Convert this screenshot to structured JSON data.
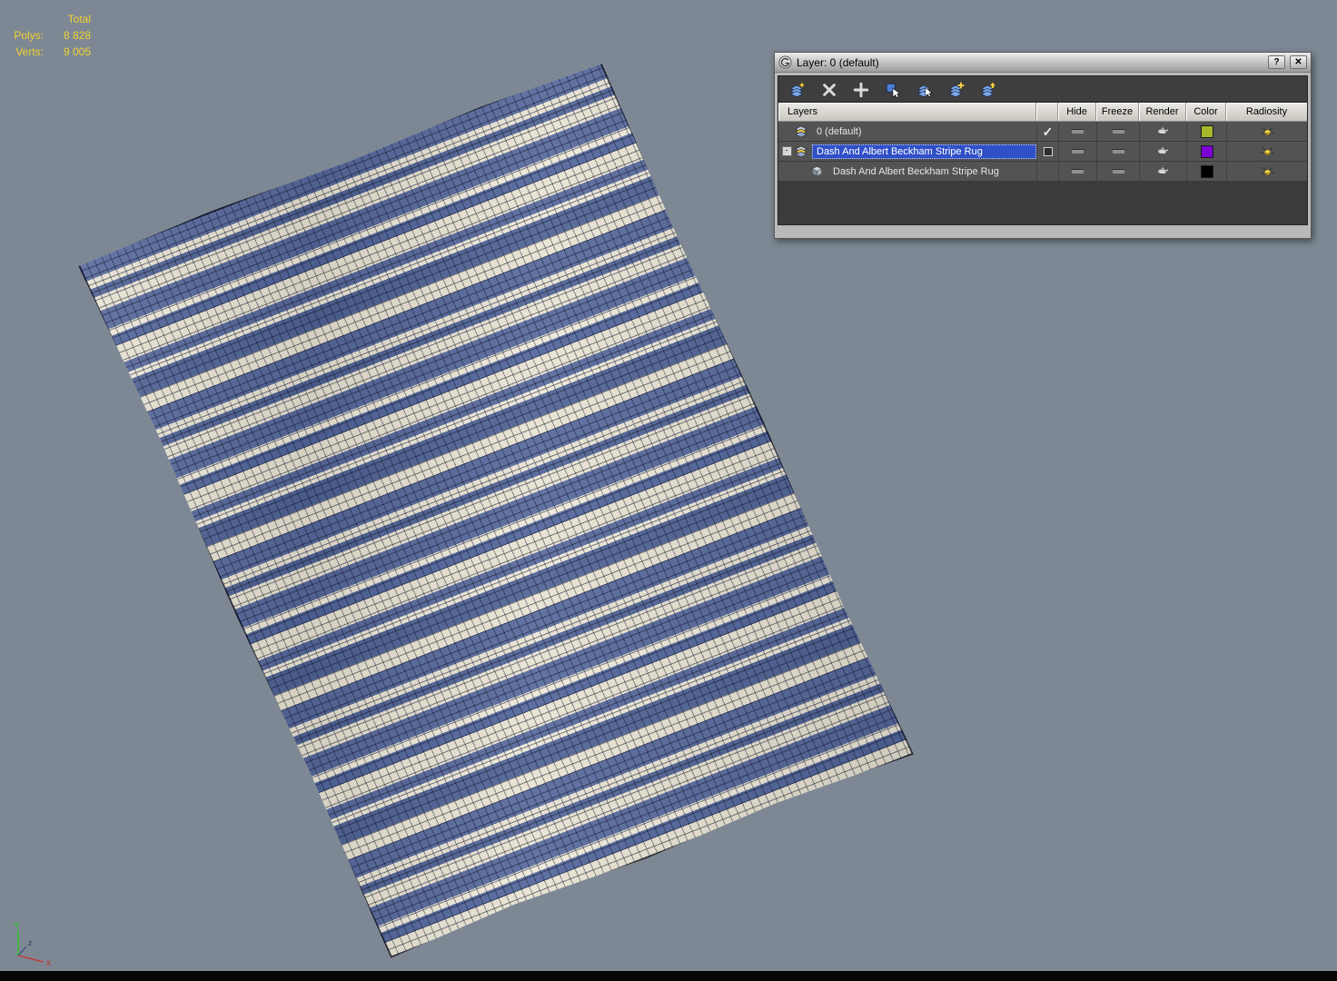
{
  "viewport": {
    "stats": {
      "total_label": "Total",
      "polys_label": "Polys:",
      "polys_value": "8 828",
      "verts_label": "Verts:",
      "verts_value": "9 005"
    },
    "axis_labels": {
      "x": "x",
      "y": "Y",
      "z": "z"
    },
    "colors": {
      "background": "#7d8894",
      "rug_blue": "#56689b",
      "rug_cream": "#e7e2d2",
      "stats_text": "#f2d231"
    }
  },
  "layer_dialog": {
    "title": "Layer: 0 (default)",
    "titlebar_buttons": {
      "help": "?",
      "close": "✕"
    },
    "toolbar_icons": [
      {
        "name": "create-new-layer-icon"
      },
      {
        "name": "delete-empty-layer-icon"
      },
      {
        "name": "add-selection-to-layer-icon"
      },
      {
        "name": "select-highlighted-objects-icon"
      },
      {
        "name": "highlight-selected-objects-layer-icon"
      },
      {
        "name": "add-to-highlighted-layer-icon"
      },
      {
        "name": "collapse-layer-icon"
      }
    ],
    "columns": [
      "Layers",
      "Hide",
      "Freeze",
      "Render",
      "Color",
      "Radiosity"
    ],
    "rows": [
      {
        "label": "0 (default)",
        "kind": "layer",
        "current_mark": "✓",
        "expander": "",
        "color": "#a6b82a",
        "selected": false
      },
      {
        "label": "Dash And Albert Beckham Stripe Rug",
        "kind": "layer",
        "current_mark": "",
        "expander": "-",
        "color": "#7d00d4",
        "selected": true
      },
      {
        "label": "Dash And Albert Beckham Stripe Rug",
        "kind": "object",
        "current_mark": "",
        "expander": "",
        "color": "#000000",
        "selected": false
      }
    ]
  }
}
